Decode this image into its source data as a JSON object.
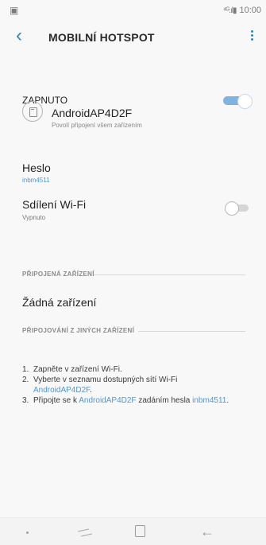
{
  "status_bar": {
    "left_icon": "image-icon",
    "right_text": "10:00"
  },
  "header": {
    "back_icon": "back-chevron-icon",
    "title": "MOBILNÍ HOTSPOT",
    "menu_icon": "more-vert-icon"
  },
  "main_toggle": {
    "label": "ZAPNUTO",
    "state": true,
    "accent": "#7fb3e0"
  },
  "network": {
    "icon": "phone-connect-icon",
    "name": "AndroidAP4D2F",
    "subtitle": "Povolí připojení všem zařízením"
  },
  "password": {
    "label": "Heslo",
    "value": "inbm4511"
  },
  "wifi_sharing": {
    "label": "Sdílení Wi-Fi",
    "status": "Vypnuto",
    "state": false
  },
  "connected_devices": {
    "section_title": "PŘIPOJENÁ ZAŘÍZENÍ",
    "empty_text": "Žádná zařízení"
  },
  "connecting": {
    "section_title": "PŘIPOJOVÁNÍ Z JINÝCH ZAŘÍZENÍ",
    "steps": [
      {
        "number": "1.",
        "text": "Zapněte v zařízení Wi-Fi."
      },
      {
        "number": "2.",
        "text_prefix": "Vyberte v seznamu dostupných sítí Wi-Fi",
        "ssid": "AndroidAP4D2F",
        "text_suffix": "."
      },
      {
        "number": "3.",
        "text_prefix": "Připojte se k",
        "ssid": "AndroidAP4D2F",
        "text_middle": "zadáním hesla",
        "password": "inbm4511",
        "text_suffix": "."
      }
    ]
  },
  "navigation_bar": {
    "dot_icon": "nav-dot-icon",
    "recent_icon": "recent-apps-icon",
    "home_icon": "home-icon",
    "back_icon": "back-arrow-icon"
  }
}
